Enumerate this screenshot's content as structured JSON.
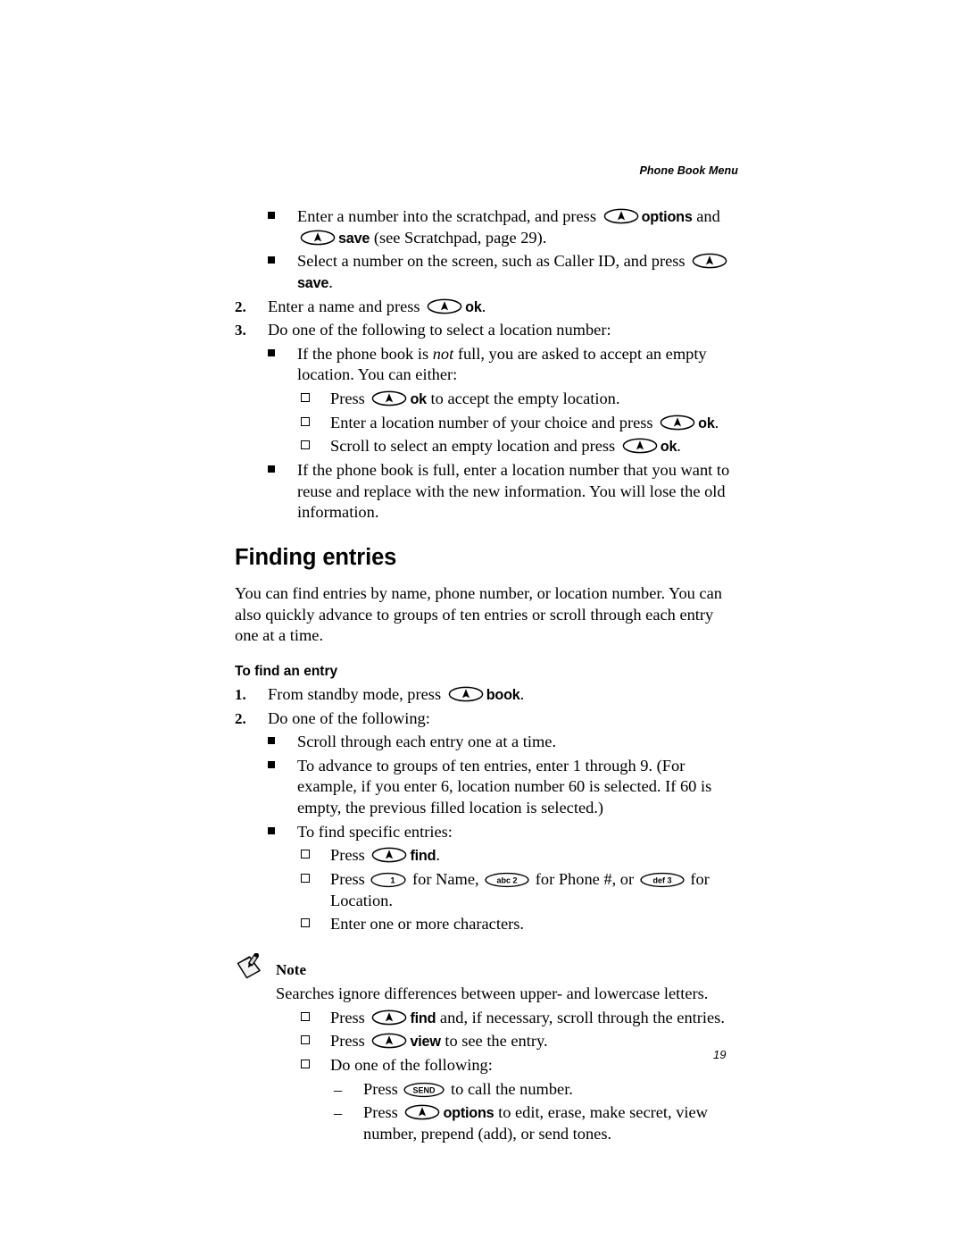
{
  "header": {
    "running_head": "Phone Book Menu"
  },
  "folio": {
    "page_number": "19"
  },
  "icons": {
    "softkey": "softkey-up-arrow-icon",
    "key_1": "1",
    "key_2": "abc 2",
    "key_3": "def 3",
    "key_send": "SEND",
    "note": "note-pencil-paper-icon"
  },
  "blocks": [
    {
      "type": "bullet",
      "level": "square",
      "parts": [
        {
          "t": "text",
          "v": "Enter a number into the scratchpad, and press "
        },
        {
          "t": "softkey"
        },
        {
          "t": "bold",
          "v": "options"
        },
        {
          "t": "text",
          "v": " and "
        },
        {
          "t": "softkey"
        },
        {
          "t": "bold",
          "v": "save"
        },
        {
          "t": "text",
          "v": " (see Scratchpad, page 29)."
        }
      ]
    },
    {
      "type": "bullet",
      "level": "square",
      "parts": [
        {
          "t": "text",
          "v": "Select a number on the screen, such as Caller ID, and press "
        },
        {
          "t": "softkey"
        },
        {
          "t": "bold",
          "v": "save"
        },
        {
          "t": "text",
          "v": "."
        }
      ]
    },
    {
      "type": "numbered",
      "marker": "2.",
      "parts": [
        {
          "t": "text",
          "v": "Enter a name and press "
        },
        {
          "t": "softkey"
        },
        {
          "t": "bold",
          "v": "ok"
        },
        {
          "t": "text",
          "v": "."
        }
      ]
    },
    {
      "type": "numbered",
      "marker": "3.",
      "parts": [
        {
          "t": "text",
          "v": "Do one of the following to select a location number:"
        }
      ]
    },
    {
      "type": "bullet",
      "level": "square",
      "parts": [
        {
          "t": "text",
          "v": "If the phone book is "
        },
        {
          "t": "italic",
          "v": "not"
        },
        {
          "t": "text",
          "v": " full, you are asked to accept an empty location. You can either:"
        }
      ]
    },
    {
      "type": "bullet",
      "level": "hollow",
      "parts": [
        {
          "t": "text",
          "v": "Press "
        },
        {
          "t": "softkey"
        },
        {
          "t": "bold",
          "v": "ok"
        },
        {
          "t": "text",
          "v": " to accept the empty location."
        }
      ]
    },
    {
      "type": "bullet",
      "level": "hollow",
      "parts": [
        {
          "t": "text",
          "v": "Enter a location number of your choice and press "
        },
        {
          "t": "softkey"
        },
        {
          "t": "bold",
          "v": "ok"
        },
        {
          "t": "text",
          "v": "."
        }
      ]
    },
    {
      "type": "bullet",
      "level": "hollow",
      "parts": [
        {
          "t": "text",
          "v": "Scroll to select an empty location and press "
        },
        {
          "t": "softkey"
        },
        {
          "t": "bold",
          "v": "ok"
        },
        {
          "t": "text",
          "v": "."
        }
      ]
    },
    {
      "type": "bullet",
      "level": "square",
      "parts": [
        {
          "t": "text",
          "v": "If the phone book is full, enter a location number that you want to reuse and replace with the new information. You will lose the old information."
        }
      ]
    },
    {
      "type": "heading",
      "text": "Finding entries"
    },
    {
      "type": "paragraph",
      "parts": [
        {
          "t": "text",
          "v": "You can find entries by name, phone number, or location number. You can also quickly advance to groups of ten entries or scroll through each entry one at a time."
        }
      ]
    },
    {
      "type": "subheading",
      "text": "To find an entry"
    },
    {
      "type": "numbered",
      "marker": "1.",
      "parts": [
        {
          "t": "text",
          "v": "From standby mode, press "
        },
        {
          "t": "softkey"
        },
        {
          "t": "bold",
          "v": "book"
        },
        {
          "t": "text",
          "v": "."
        }
      ]
    },
    {
      "type": "numbered",
      "marker": "2.",
      "parts": [
        {
          "t": "text",
          "v": "Do one of the following:"
        }
      ]
    },
    {
      "type": "bullet",
      "level": "square",
      "parts": [
        {
          "t": "text",
          "v": "Scroll through each entry one at a time."
        }
      ]
    },
    {
      "type": "bullet",
      "level": "square",
      "parts": [
        {
          "t": "text",
          "v": "To advance to groups of ten entries, enter 1 through 9. (For example, if you enter 6, location number 60 is selected. If 60 is empty, the previous filled location is selected.)"
        }
      ]
    },
    {
      "type": "bullet",
      "level": "square",
      "parts": [
        {
          "t": "text",
          "v": "To find specific entries:"
        }
      ]
    },
    {
      "type": "bullet",
      "level": "hollow",
      "parts": [
        {
          "t": "text",
          "v": "Press "
        },
        {
          "t": "softkey"
        },
        {
          "t": "bold",
          "v": "find"
        },
        {
          "t": "text",
          "v": "."
        }
      ]
    },
    {
      "type": "bullet",
      "level": "hollow",
      "parts": [
        {
          "t": "text",
          "v": "Press "
        },
        {
          "t": "keycap",
          "v": "key_1"
        },
        {
          "t": "text",
          "v": " for Name, "
        },
        {
          "t": "keycap",
          "v": "key_2"
        },
        {
          "t": "text",
          "v": " for Phone #, or "
        },
        {
          "t": "keycap",
          "v": "key_3"
        },
        {
          "t": "text",
          "v": " for Location."
        }
      ]
    },
    {
      "type": "bullet",
      "level": "hollow",
      "parts": [
        {
          "t": "text",
          "v": "Enter one or more characters."
        }
      ]
    },
    {
      "type": "note",
      "title": "Note",
      "body": "Searches ignore differences between upper- and lowercase letters."
    },
    {
      "type": "bullet",
      "level": "hollow",
      "parts": [
        {
          "t": "text",
          "v": "Press "
        },
        {
          "t": "softkey"
        },
        {
          "t": "bold",
          "v": "find"
        },
        {
          "t": "text",
          "v": " and, if necessary, scroll through the entries."
        }
      ]
    },
    {
      "type": "bullet",
      "level": "hollow",
      "parts": [
        {
          "t": "text",
          "v": "Press "
        },
        {
          "t": "softkey"
        },
        {
          "t": "bold",
          "v": "view"
        },
        {
          "t": "text",
          "v": " to see the entry."
        }
      ]
    },
    {
      "type": "bullet",
      "level": "hollow",
      "parts": [
        {
          "t": "text",
          "v": "Do one of the following:"
        }
      ]
    },
    {
      "type": "bullet",
      "level": "dash",
      "parts": [
        {
          "t": "text",
          "v": "Press "
        },
        {
          "t": "keycap",
          "v": "key_send"
        },
        {
          "t": "text",
          "v": " to call the number."
        }
      ]
    },
    {
      "type": "bullet",
      "level": "dash",
      "parts": [
        {
          "t": "text",
          "v": "Press "
        },
        {
          "t": "softkey"
        },
        {
          "t": "bold",
          "v": "options"
        },
        {
          "t": "text",
          "v": " to edit, erase, make secret, view number, prepend (add), or send tones."
        }
      ]
    }
  ]
}
